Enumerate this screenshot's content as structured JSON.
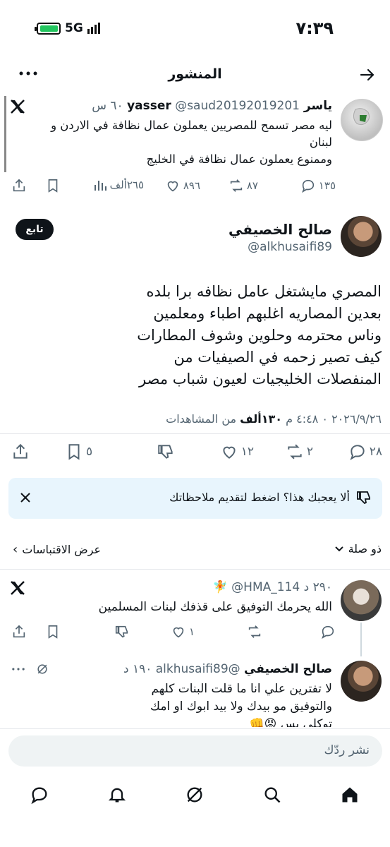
{
  "status_bar": {
    "time": "٧:٣٩",
    "network": "5G",
    "battery_level": 0.85
  },
  "header": {
    "title": "المنشور"
  },
  "quoted_tweet": {
    "author_name": "ياسر yasser",
    "handle": "@saud20192019201",
    "time": "٦٠ س",
    "lines": [
      "ليه مصر تسمح للمصريين يعملون عمال نظافة في الاردن و",
      "لبنان",
      "وممنوع يعملون عمال نظافة في الخليج"
    ],
    "replies": "١٣٥",
    "retweets": "٨٧",
    "likes": "٨٩٦",
    "views": "٢٦٥ألف"
  },
  "main_tweet": {
    "author_name": "صالح الخصيفي",
    "handle": "@alkhusaifi89",
    "follow_label": "تابع",
    "lines": [
      "المصري مايشتغل عامل نظافه برا بلده",
      "بعدين المصاريه اغلبهم اطباء ومعلمين",
      "وناس محترمه وحلوين وشوف المطارات",
      "كيف تصير زحمه في الصيفيات من",
      "المنفصلات الخليجيات لعيون شباب مصر"
    ],
    "time_date": "٢٠٢٦/٩/٢٦ ٠ ٤:٤٨ م",
    "views_count": "١٣٠ألف",
    "views_label": "من المشاهدات",
    "replies": "٢٨",
    "retweets": "٢",
    "likes": "١٢",
    "bookmarks": "٥"
  },
  "feedback": {
    "text": "ألا يعجبك هذا؟ اضغط لتقديم ملاحظاتك"
  },
  "sort_bar": {
    "relevance": "ذو صلة",
    "quotes": "عرض الاقتباسات"
  },
  "reply_1": {
    "author_name": "HMA_114",
    "handle": "@HMA_114",
    "time": "٢٩٠ د",
    "emoji": "🧚",
    "text": "الله يحرمك التوفيق على قذفك لبنات المسلمين",
    "likes": "١"
  },
  "reply_2": {
    "author_name": "صالح الخصيفي",
    "handle": "@alkhusaifi89",
    "time": "١٩٠ د",
    "lines": [
      "لا تفترين علي انا ما قلت البنات كلهم",
      "والتوفيق مو بيدك ولا بيد ابوك او امك",
      "توكلي بس 😡👊"
    ]
  },
  "composer": {
    "placeholder": "نشر ردّك"
  },
  "colors": {
    "accent": "#1d9bf0",
    "text": "#0f1419",
    "muted": "#536471"
  },
  "icons": [
    "back-arrow-icon",
    "more-icon",
    "x-logo-icon",
    "reply-icon",
    "retweet-icon",
    "like-icon",
    "views-icon",
    "bookmark-icon",
    "share-icon",
    "dislike-icon",
    "close-icon",
    "chevron-down-icon",
    "grok-icon",
    "home-icon",
    "search-icon",
    "notifications-icon",
    "messages-icon"
  ]
}
